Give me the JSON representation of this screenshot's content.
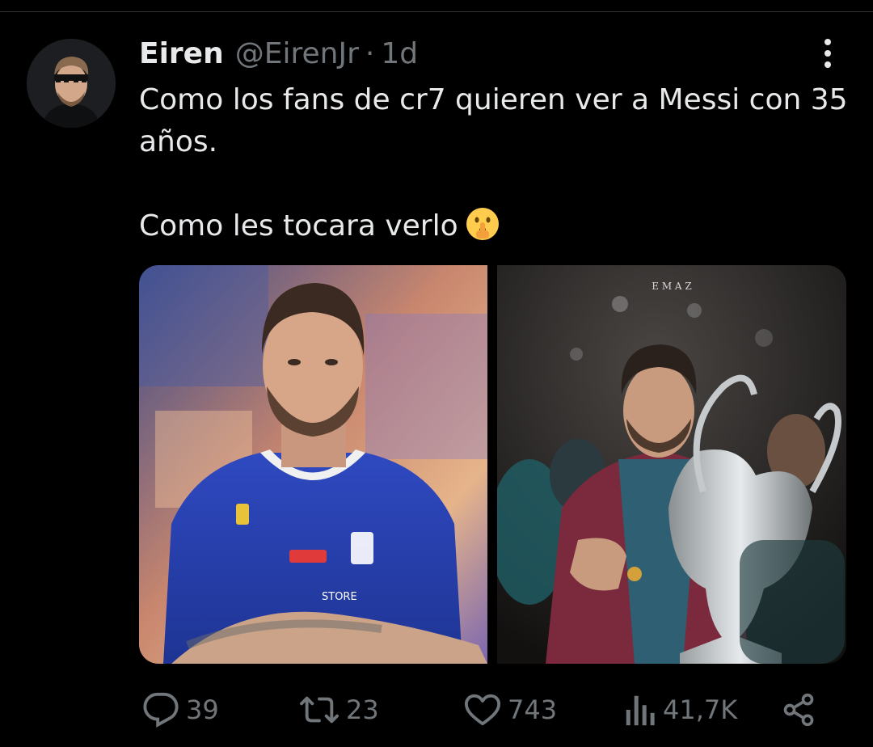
{
  "tweet": {
    "author_name": "Eiren",
    "handle": "@EirenJr",
    "separator": "·",
    "time": "1d",
    "text_line1": "Como los fans de cr7 quieren ver a Messi con 35 años.",
    "text_line2": "Como les tocara verlo",
    "emoji": "shushing-face-emoji",
    "media": [
      {
        "image_text": "STORE"
      },
      {
        "watermark": "E M A Z"
      }
    ]
  },
  "actions": {
    "reply_count": "39",
    "retweet_count": "23",
    "like_count": "743",
    "views_count": "41,7K"
  },
  "icons": [
    "more-icon",
    "reply-icon",
    "retweet-icon",
    "like-icon",
    "views-icon",
    "share-icon"
  ],
  "colors": {
    "background": "#000000",
    "text": "#e7e9ea",
    "secondary": "#71767b",
    "divider": "#2f3336"
  }
}
